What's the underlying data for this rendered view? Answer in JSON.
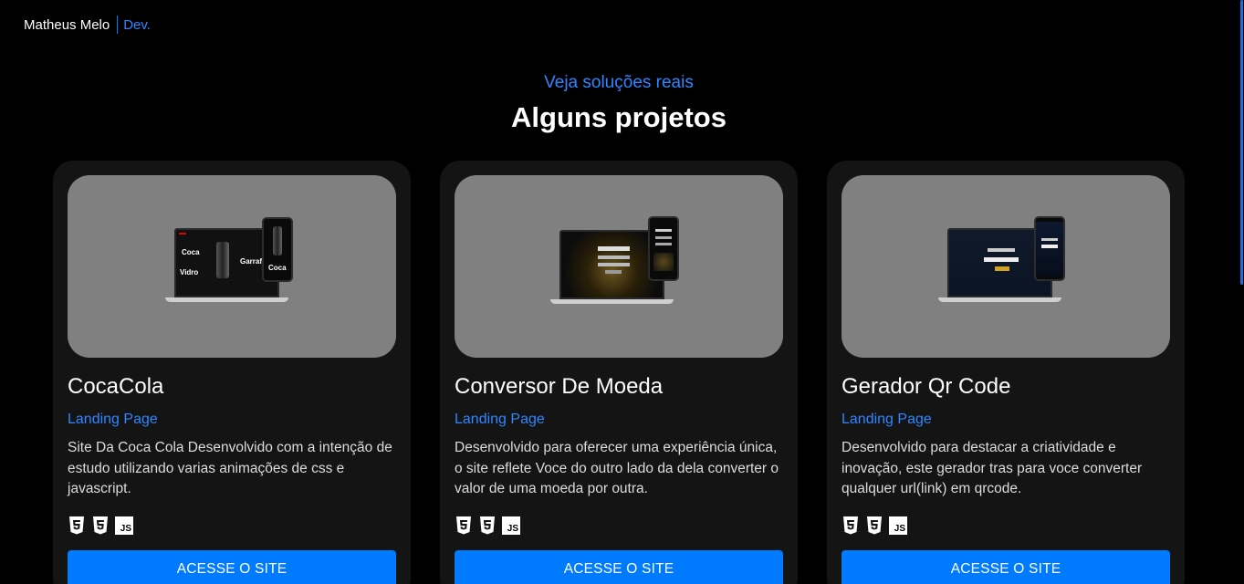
{
  "header": {
    "brand_name": "Matheus Melo",
    "brand_suffix": "Dev."
  },
  "section": {
    "subtitle": "Veja soluções reais",
    "title": "Alguns projetos"
  },
  "projects": [
    {
      "title": "CocaCola",
      "tag": "Landing Page",
      "description": "Site Da Coca Cola Desenvolvido com a intenção de estudo utilizando varias animações de css e javascript.",
      "button_label": "ACESSE O SITE",
      "tech": [
        "html5-icon",
        "css3-icon",
        "js-icon"
      ],
      "mockup_text": {
        "laptop_line1": "Coca",
        "laptop_line2": "Garraf",
        "laptop_line3": "Vidro",
        "phone_line": "Coca"
      }
    },
    {
      "title": "Conversor De Moeda",
      "tag": "Landing Page",
      "description": "Desenvolvido para oferecer uma experiência única, o site reflete Voce do outro lado da dela converter o valor de uma moeda por outra.",
      "button_label": "ACESSE O SITE",
      "tech": [
        "html5-icon",
        "css3-icon",
        "js-icon"
      ]
    },
    {
      "title": "Gerador Qr Code",
      "tag": "Landing Page",
      "description": "Desenvolvido para destacar a criatividade e inovação, este gerador tras para voce converter qualquer url(link) em qrcode.",
      "button_label": "ACESSE O SITE",
      "tech": [
        "html5-icon",
        "css3-icon",
        "js-icon"
      ]
    }
  ],
  "js_badge_label": "JS",
  "colors": {
    "accent": "#007bff",
    "accent_text": "#2f86ff",
    "card_bg": "#141414",
    "thumb_bg": "#808080",
    "page_bg": "#000000"
  }
}
